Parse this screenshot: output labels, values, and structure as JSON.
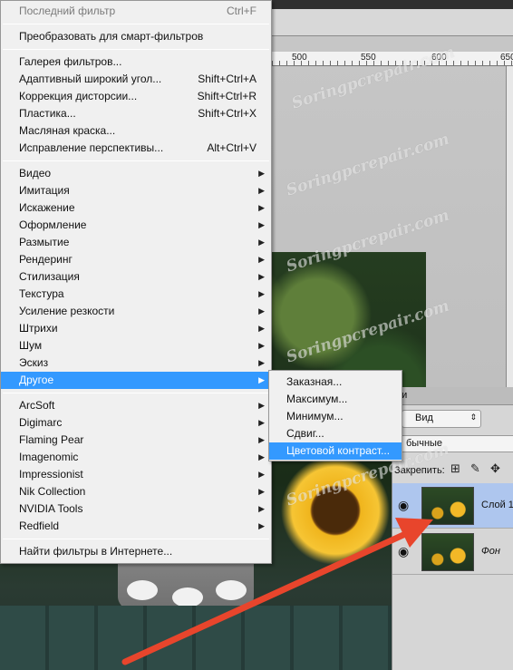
{
  "ruler": {
    "labels": [
      "500",
      "550",
      "600",
      "650"
    ]
  },
  "watermark": {
    "text": "Soringpcrepair.com"
  },
  "menu": {
    "last_filter": {
      "label": "Последний фильтр",
      "shortcut": "Ctrl+F"
    },
    "smart_filters": {
      "label": "Преобразовать для смарт-фильтров"
    },
    "group1": [
      {
        "label": "Галерея фильтров...",
        "shortcut": ""
      },
      {
        "label": "Адаптивный широкий угол...",
        "shortcut": "Shift+Ctrl+A"
      },
      {
        "label": "Коррекция дисторсии...",
        "shortcut": "Shift+Ctrl+R"
      },
      {
        "label": "Пластика...",
        "shortcut": "Shift+Ctrl+X"
      },
      {
        "label": "Масляная краска...",
        "shortcut": ""
      },
      {
        "label": "Исправление перспективы...",
        "shortcut": "Alt+Ctrl+V"
      }
    ],
    "group2": [
      {
        "label": "Видео"
      },
      {
        "label": "Имитация"
      },
      {
        "label": "Искажение"
      },
      {
        "label": "Оформление"
      },
      {
        "label": "Размытие"
      },
      {
        "label": "Рендеринг"
      },
      {
        "label": "Стилизация"
      },
      {
        "label": "Текстура"
      },
      {
        "label": "Усиление резкости"
      },
      {
        "label": "Штрихи"
      },
      {
        "label": "Шум"
      },
      {
        "label": "Эскиз"
      },
      {
        "label": "Другое"
      }
    ],
    "group3": [
      {
        "label": "ArcSoft"
      },
      {
        "label": "Digimarc"
      },
      {
        "label": "Flaming Pear"
      },
      {
        "label": "Imagenomic"
      },
      {
        "label": "Impressionist"
      },
      {
        "label": "Nik Collection"
      },
      {
        "label": "NVIDIA Tools"
      },
      {
        "label": "Redfield"
      }
    ],
    "find_online": {
      "label": "Найти фильтры в Интернете..."
    },
    "submenu_arrow": "▶"
  },
  "submenu": {
    "items": [
      {
        "label": "Заказная..."
      },
      {
        "label": "Максимум..."
      },
      {
        "label": "Минимум..."
      },
      {
        "label": "Сдвиг..."
      },
      {
        "label": "Цветовой контраст..."
      }
    ]
  },
  "layers": {
    "tab_label": "ои",
    "kind": "Вид",
    "blend_mode": "бычные",
    "lock_label": "Закрепить:",
    "rows": [
      {
        "name": "Слой 1"
      },
      {
        "name": "Фон"
      }
    ]
  },
  "colors": {
    "highlight": "#3399ff",
    "arrow": "#e8452c",
    "selected_layer": "#aec6ee"
  }
}
